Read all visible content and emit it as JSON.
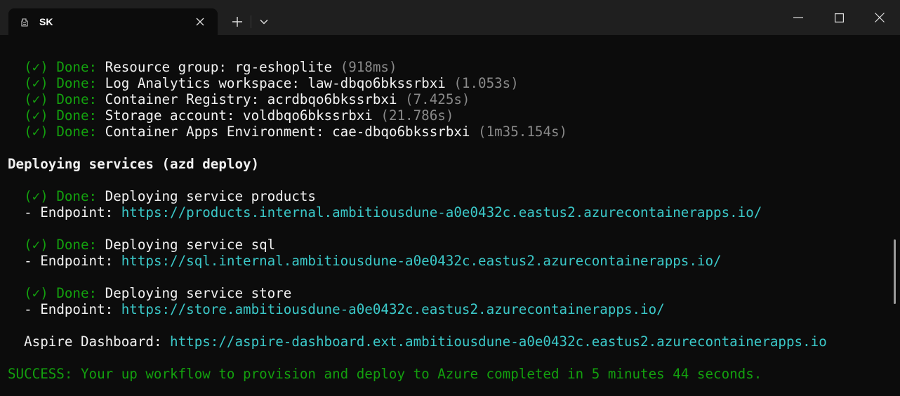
{
  "window": {
    "tab_title": "SK",
    "icons": {
      "tab": "terminal-profile-icon",
      "close_tab": "close-icon",
      "new_tab": "plus-icon",
      "dropdown": "chevron-down-icon",
      "minimize": "minimize-icon",
      "maximize": "maximize-icon",
      "close_window": "close-icon"
    }
  },
  "colors": {
    "success": "#13a10e",
    "text": "#f2f2f2",
    "muted": "#8a8a8a",
    "link": "#3bc9c9",
    "background": "#0c0c0c",
    "titlebar": "#1f1f1f"
  },
  "provision": [
    {
      "status": "(✓) Done: ",
      "resource": "Resource group: rg-eshoplite ",
      "duration": "(918ms)"
    },
    {
      "status": "(✓) Done: ",
      "resource": "Log Analytics workspace: law-dbqo6bkssrbxi ",
      "duration": "(1.053s)"
    },
    {
      "status": "(✓) Done: ",
      "resource": "Container Registry: acrdbqo6bkssrbxi ",
      "duration": "(7.425s)"
    },
    {
      "status": "(✓) Done: ",
      "resource": "Storage account: voldbqo6bkssrbxi ",
      "duration": "(21.786s)"
    },
    {
      "status": "(✓) Done: ",
      "resource": "Container Apps Environment: cae-dbqo6bkssrbxi ",
      "duration": "(1m35.154s)"
    }
  ],
  "deploy_heading": "Deploying services (azd deploy)",
  "services": [
    {
      "status": "(✓) Done: ",
      "label": "Deploying service products",
      "endpoint_label": "- Endpoint: ",
      "endpoint": "https://products.internal.ambitiousdune-a0e0432c.eastus2.azurecontainerapps.io/"
    },
    {
      "status": "(✓) Done: ",
      "label": "Deploying service sql",
      "endpoint_label": "- Endpoint: ",
      "endpoint": "https://sql.internal.ambitiousdune-a0e0432c.eastus2.azurecontainerapps.io/"
    },
    {
      "status": "(✓) Done: ",
      "label": "Deploying service store",
      "endpoint_label": "- Endpoint: ",
      "endpoint": "https://store.ambitiousdune-a0e0432c.eastus2.azurecontainerapps.io/"
    }
  ],
  "dashboard": {
    "label": "Aspire Dashboard: ",
    "url": "https://aspire-dashboard.ext.ambitiousdune-a0e0432c.eastus2.azurecontainerapps.io"
  },
  "success_message": "SUCCESS: Your up workflow to provision and deploy to Azure completed in 5 minutes 44 seconds."
}
